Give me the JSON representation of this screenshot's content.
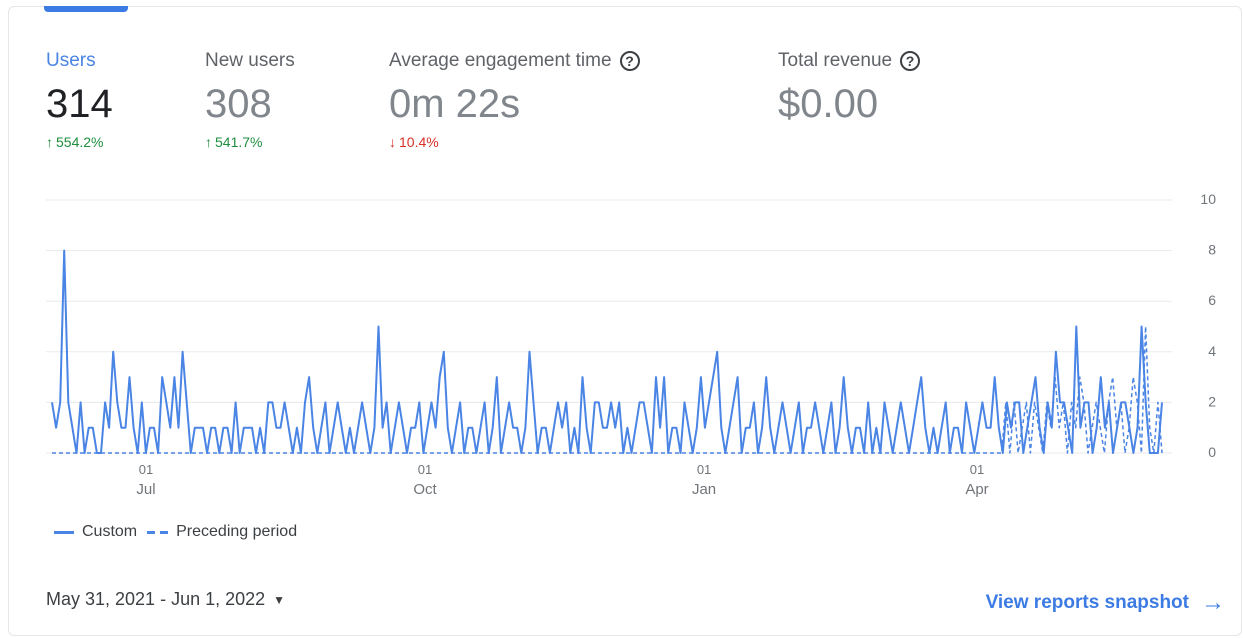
{
  "metrics": [
    {
      "label": "Users",
      "value": "314",
      "change": "554.2%",
      "direction": "up"
    },
    {
      "label": "New users",
      "value": "308",
      "change": "541.7%",
      "direction": "up"
    },
    {
      "label": "Average engagement time",
      "value": "0m 22s",
      "change": "10.4%",
      "direction": "down",
      "help_icon": "question-circle-icon"
    },
    {
      "label": "Total revenue",
      "value": "$0.00",
      "change": "",
      "direction": "",
      "help_icon": "question-circle-icon"
    }
  ],
  "legend": {
    "current": "Custom",
    "preceding": "Preceding period"
  },
  "footer": {
    "date_range": "May 31, 2021 - Jun 1, 2022",
    "link_label": "View reports snapshot"
  },
  "colors": {
    "accent": "#4a84e4",
    "up": "#1e8e3e",
    "down": "#d93025"
  },
  "chart_data": {
    "type": "line",
    "ylim": [
      0,
      10
    ],
    "y_ticks": [
      "0",
      "2",
      "4",
      "6",
      "8",
      "10"
    ],
    "x_ticks": [
      {
        "day": "01",
        "month": "Jul"
      },
      {
        "day": "01",
        "month": "Oct"
      },
      {
        "day": "01",
        "month": "Jan"
      },
      {
        "day": "01",
        "month": "Apr"
      }
    ],
    "x_tick_dates": [
      "2021-07-01",
      "2021-10-01",
      "2022-01-01",
      "2022-04-01"
    ],
    "x_start": "2021-05-31",
    "x_end": "2022-06-01",
    "grid": true,
    "legend_position": "bottom-left",
    "series": [
      {
        "name": "Custom",
        "style": "solid",
        "values": [
          2,
          1,
          2,
          8,
          2,
          1,
          0,
          2,
          0,
          1,
          1,
          0,
          0,
          2,
          1,
          4,
          2,
          1,
          1,
          3,
          1,
          0,
          2,
          0,
          1,
          1,
          0,
          3,
          2,
          1,
          3,
          1,
          4,
          2,
          0,
          1,
          1,
          1,
          0,
          1,
          1,
          0,
          1,
          1,
          0,
          2,
          0,
          1,
          1,
          1,
          0,
          1,
          0,
          2,
          2,
          1,
          1,
          2,
          1,
          0,
          1,
          0,
          2,
          3,
          1,
          0,
          1,
          2,
          0,
          1,
          2,
          1,
          0,
          1,
          0,
          1,
          2,
          1,
          0,
          1,
          5,
          1,
          2,
          0,
          1,
          2,
          1,
          0,
          1,
          1,
          2,
          0,
          1,
          2,
          1,
          3,
          4,
          1,
          0,
          1,
          2,
          0,
          1,
          1,
          0,
          1,
          2,
          0,
          1,
          3,
          0,
          1,
          2,
          1,
          1,
          0,
          1,
          4,
          2,
          0,
          1,
          1,
          0,
          1,
          2,
          1,
          2,
          0,
          1,
          0,
          3,
          1,
          0,
          2,
          2,
          1,
          1,
          2,
          1,
          2,
          0,
          1,
          0,
          1,
          2,
          2,
          1,
          0,
          3,
          1,
          3,
          0,
          1,
          1,
          0,
          2,
          1,
          0,
          1,
          3,
          1,
          2,
          3,
          4,
          1,
          0,
          1,
          2,
          3,
          0,
          1,
          1,
          2,
          0,
          1,
          3,
          1,
          0,
          1,
          2,
          1,
          0,
          1,
          2,
          0,
          1,
          1,
          2,
          1,
          0,
          1,
          2,
          0,
          1,
          3,
          1,
          0,
          1,
          1,
          0,
          2,
          0,
          1,
          0,
          2,
          1,
          0,
          1,
          2,
          1,
          0,
          1,
          2,
          3,
          1,
          0,
          1,
          0,
          1,
          2,
          0,
          1,
          1,
          0,
          2,
          1,
          0,
          1,
          2,
          1,
          1,
          3,
          1,
          0,
          2,
          1,
          2,
          2,
          0,
          1,
          2,
          3,
          1,
          0,
          2,
          1,
          4,
          2,
          2,
          1,
          0,
          5,
          1,
          2,
          2,
          0,
          1,
          3,
          1,
          2,
          0,
          1,
          2,
          2,
          1,
          0,
          1,
          5,
          2,
          0,
          0,
          0,
          2
        ]
      },
      {
        "name": "Preceding period",
        "style": "dashed",
        "values": [
          0,
          0,
          0,
          0,
          0,
          0,
          0,
          0,
          0,
          0,
          0,
          0,
          0,
          0,
          0,
          0,
          0,
          0,
          0,
          0,
          0,
          0,
          0,
          0,
          0,
          0,
          0,
          0,
          0,
          0,
          0,
          0,
          0,
          0,
          0,
          0,
          0,
          0,
          0,
          0,
          0,
          0,
          0,
          0,
          0,
          0,
          0,
          0,
          0,
          0,
          0,
          0,
          0,
          0,
          0,
          0,
          0,
          0,
          0,
          0,
          0,
          0,
          0,
          0,
          0,
          0,
          0,
          0,
          0,
          0,
          0,
          0,
          0,
          0,
          0,
          0,
          0,
          0,
          0,
          0,
          0,
          0,
          0,
          0,
          0,
          0,
          0,
          0,
          0,
          0,
          0,
          0,
          0,
          0,
          0,
          0,
          0,
          0,
          0,
          0,
          0,
          0,
          0,
          0,
          0,
          0,
          0,
          0,
          0,
          0,
          0,
          0,
          0,
          0,
          0,
          0,
          0,
          0,
          0,
          0,
          0,
          0,
          0,
          0,
          0,
          0,
          0,
          0,
          0,
          0,
          0,
          0,
          0,
          0,
          0,
          0,
          0,
          0,
          0,
          0,
          0,
          0,
          0,
          0,
          0,
          0,
          0,
          0,
          0,
          0,
          0,
          0,
          0,
          0,
          0,
          0,
          0,
          0,
          0,
          0,
          0,
          0,
          0,
          0,
          0,
          0,
          0,
          0,
          0,
          0,
          0,
          0,
          0,
          0,
          0,
          0,
          0,
          0,
          0,
          0,
          0,
          0,
          0,
          0,
          0,
          0,
          0,
          0,
          0,
          0,
          0,
          0,
          0,
          0,
          0,
          0,
          0,
          0,
          0,
          0,
          0,
          0,
          0,
          0,
          0,
          0,
          0,
          0,
          0,
          0,
          0,
          0,
          0,
          0,
          0,
          0,
          0,
          0,
          0,
          0,
          0,
          0,
          0,
          0,
          0,
          0,
          0,
          0,
          0,
          0,
          0,
          0,
          2,
          0,
          2,
          0,
          1,
          2,
          0,
          2,
          1,
          0,
          2,
          1,
          3,
          1,
          2,
          0,
          2,
          1,
          3,
          2,
          0,
          1,
          2,
          1,
          0,
          2,
          3,
          1,
          2,
          0,
          1,
          3,
          2,
          0,
          5,
          1,
          0,
          2,
          0
        ]
      }
    ]
  }
}
